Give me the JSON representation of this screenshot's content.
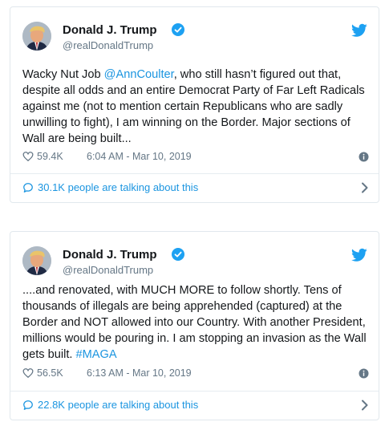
{
  "tweets": [
    {
      "author": {
        "name": "Donald J. Trump",
        "handle": "@realDonaldTrump"
      },
      "text": {
        "before": "Wacky Nut Job ",
        "mention": "@AnnCoulter",
        "after": ", who still hasn’t figured out that, despite all odds and an entire Democrat Party of Far Left Radicals against me (not to mention certain Republicans who are sadly unwilling to fight), I am winning on the Border. Major sections of Wall are being built..."
      },
      "likes": "59.4K",
      "timestamp": "6:04 AM - Mar 10, 2019",
      "talking": "30.1K people are talking about this"
    },
    {
      "author": {
        "name": "Donald J. Trump",
        "handle": "@realDonaldTrump"
      },
      "text": {
        "before": "....and renovated, with MUCH MORE to follow shortly. Tens of thousands of illegals are being apprehended (captured) at the Border and NOT allowed into our Country. With another President, millions would be pouring in. I am stopping an invasion as the Wall gets built. ",
        "hashtag": "#MAGA"
      },
      "likes": "56.5K",
      "timestamp": "6:13 AM - Mar 10, 2019",
      "talking": "22.8K people are talking about this"
    }
  ],
  "icons": {
    "verified": "verified-badge-icon",
    "bird": "twitter-bird-icon",
    "like": "heart-icon",
    "info": "info-icon",
    "reply": "speech-bubble-icon",
    "more": "chevron-right-icon"
  },
  "colors": {
    "accent": "#1da1f2",
    "link": "#1b95e0",
    "text": "#14171a",
    "muted": "#657786",
    "border": "#e1e8ed"
  }
}
